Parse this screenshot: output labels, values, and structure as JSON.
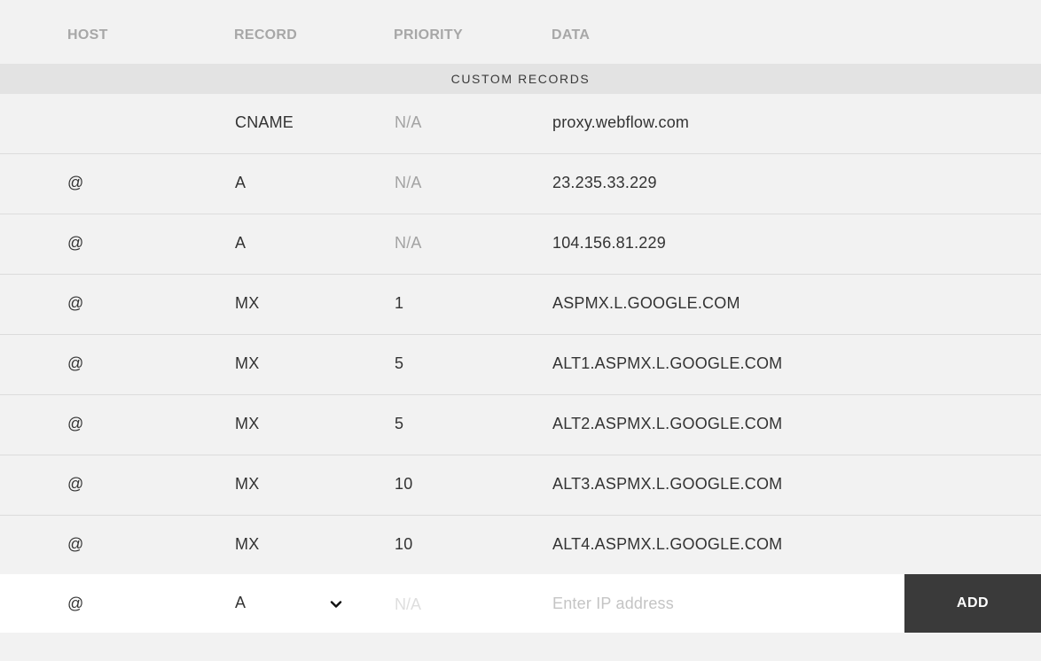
{
  "columns": {
    "host": "HOST",
    "record": "RECORD",
    "priority": "PRIORITY",
    "data": "DATA"
  },
  "section_title": "CUSTOM RECORDS",
  "records": [
    {
      "host": "",
      "record": "CNAME",
      "priority": "N/A",
      "data": "proxy.webflow.com"
    },
    {
      "host": "@",
      "record": "A",
      "priority": "N/A",
      "data": "23.235.33.229"
    },
    {
      "host": "@",
      "record": "A",
      "priority": "N/A",
      "data": "104.156.81.229"
    },
    {
      "host": "@",
      "record": "MX",
      "priority": "1",
      "data": "ASPMX.L.GOOGLE.COM"
    },
    {
      "host": "@",
      "record": "MX",
      "priority": "5",
      "data": "ALT1.ASPMX.L.GOOGLE.COM"
    },
    {
      "host": "@",
      "record": "MX",
      "priority": "5",
      "data": "ALT2.ASPMX.L.GOOGLE.COM"
    },
    {
      "host": "@",
      "record": "MX",
      "priority": "10",
      "data": "ALT3.ASPMX.L.GOOGLE.COM"
    },
    {
      "host": "@",
      "record": "MX",
      "priority": "10",
      "data": "ALT4.ASPMX.L.GOOGLE.COM"
    }
  ],
  "new_record": {
    "host": "@",
    "record_selected": "A",
    "record_icon": "chevron-down-icon",
    "priority_placeholder": "N/A",
    "data_value": "",
    "data_placeholder": "Enter IP address",
    "add_label": "ADD"
  },
  "colors": {
    "background": "#f2f2f2",
    "section_bar": "#e3e3e3",
    "header_text": "#a7a7a7",
    "na_text": "#a3a3a3",
    "add_button": "#3a3a3a",
    "input_row": "#ffffff"
  }
}
